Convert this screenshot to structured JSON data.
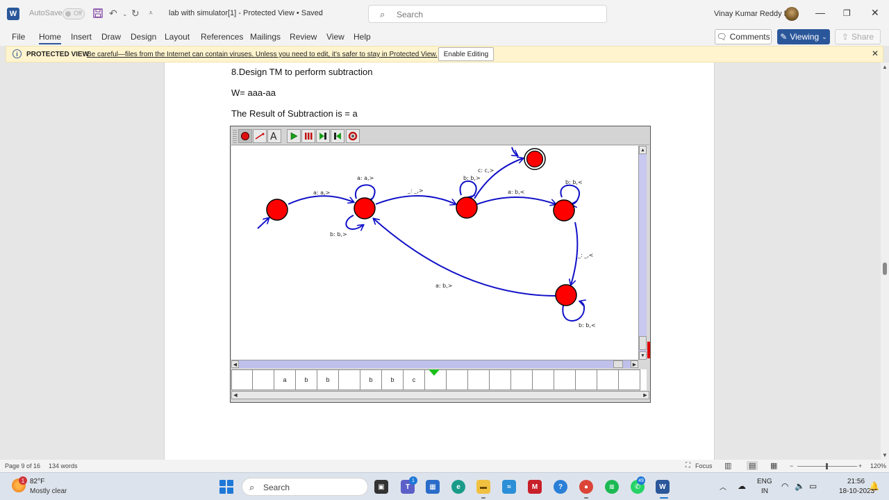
{
  "titlebar": {
    "autosave_label": "AutoSave",
    "toggle_state": "Off",
    "doc_title": "lab with simulator[1]  -  Protected View • Saved",
    "search_placeholder": "Search",
    "user_name": "Vinay Kumar Reddy R"
  },
  "menu": {
    "items": [
      "File",
      "Home",
      "Insert",
      "Draw",
      "Design",
      "Layout",
      "References",
      "Mailings",
      "Review",
      "View",
      "Help"
    ],
    "active": "Home",
    "comments_label": "Comments",
    "viewing_label": "Viewing",
    "share_label": "Share"
  },
  "protected_view": {
    "title": "PROTECTED VIEW",
    "message": "Be careful—files from the Internet can contain viruses. Unless you need to edit, it's safer to stay in Protected View.",
    "enable_button": "Enable Editing"
  },
  "document": {
    "line1": "8.Design TM to perform  subtraction",
    "line2": "W= aaa-aa",
    "line3": "The Result of Subtraction  is = a"
  },
  "simulator": {
    "transitions": {
      "t1": "a: a,>",
      "t2": "a: a,>",
      "t3": "b: b,>",
      "t4": "_: _,>",
      "t5": "b: b,>",
      "t6": "c: c,>",
      "t7": "a: b,<",
      "t8": "b: b,<",
      "t9": "_: _,<",
      "t10": "a: b,>",
      "t11": "b: b,<"
    },
    "tape_cells": [
      "",
      "",
      "a",
      "b",
      "b",
      "",
      "b",
      "b",
      "c",
      "",
      "",
      "",
      "",
      "",
      "",
      "",
      "",
      "",
      ""
    ],
    "head_index": 9
  },
  "statusbar": {
    "page": "Page 9 of 16",
    "words": "134 words",
    "focus": "Focus",
    "zoom": "120%"
  },
  "taskbar": {
    "temp": "82°F",
    "weather": "Mostly clear",
    "weather_badge": "1",
    "search": "Search",
    "teams_badge": "1",
    "whatsapp_badge": "49",
    "lang": "ENG",
    "region": "IN",
    "time": "21:56",
    "date": "18-10-2023"
  },
  "colors": {
    "word_blue": "#2b579a",
    "state_red": "#ff0000",
    "edge_blue": "#1010c8",
    "banner_yellow": "#fff4ce"
  }
}
